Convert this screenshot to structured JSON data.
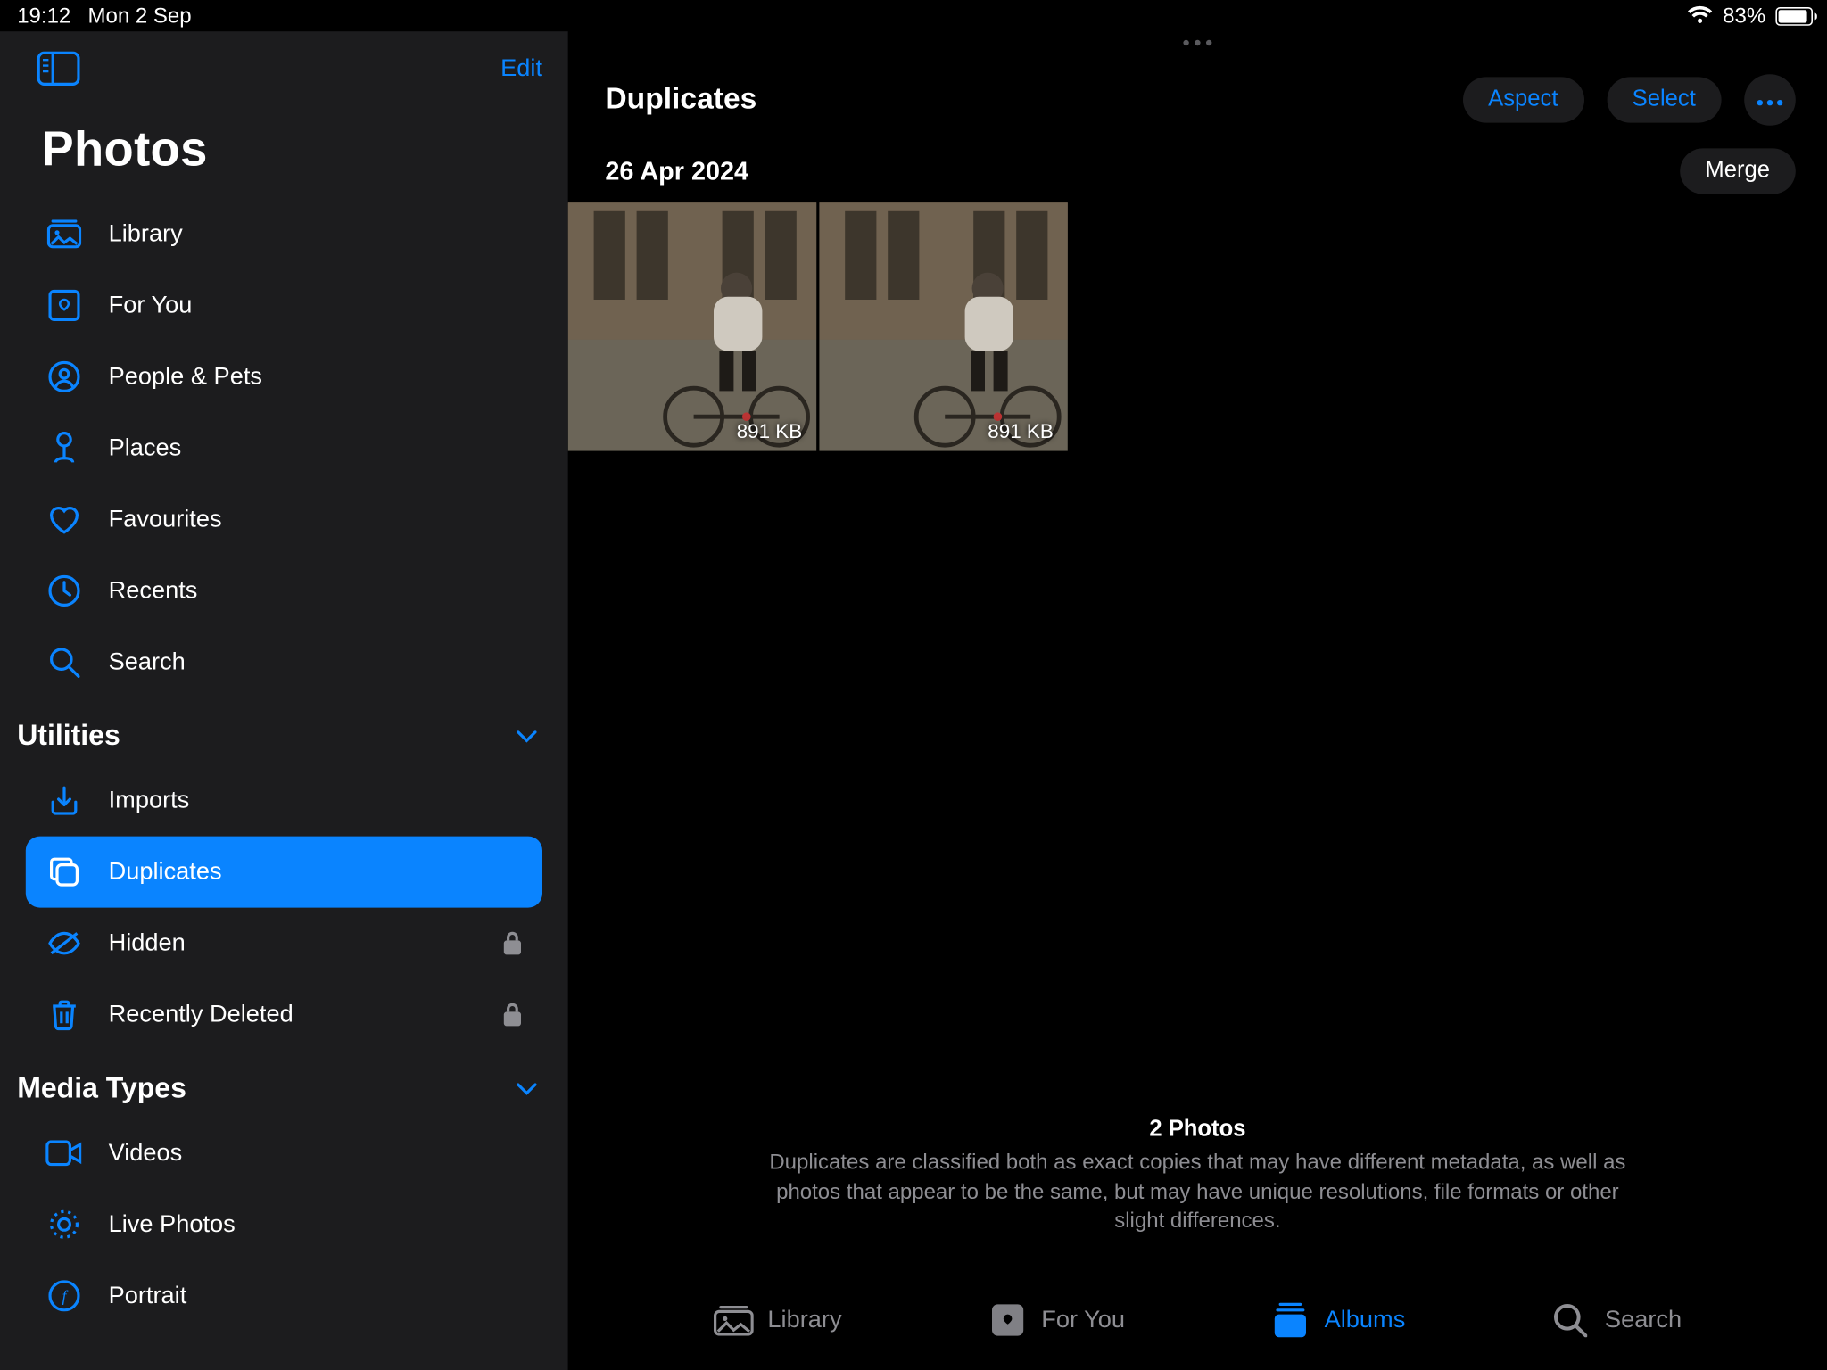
{
  "status": {
    "time": "19:12",
    "date": "Mon 2 Sep",
    "battery_pct": "83%",
    "battery_fill_pct": 83
  },
  "sidebar": {
    "edit_label": "Edit",
    "title": "Photos",
    "primary": [
      {
        "label": "Library",
        "icon": "library-icon"
      },
      {
        "label": "For You",
        "icon": "foryou-icon"
      },
      {
        "label": "People & Pets",
        "icon": "people-icon"
      },
      {
        "label": "Places",
        "icon": "places-icon"
      },
      {
        "label": "Favourites",
        "icon": "heart-icon"
      },
      {
        "label": "Recents",
        "icon": "clock-icon"
      },
      {
        "label": "Search",
        "icon": "search-icon"
      }
    ],
    "section_utilities": "Utilities",
    "utilities": [
      {
        "label": "Imports",
        "icon": "import-icon",
        "locked": false,
        "active": false
      },
      {
        "label": "Duplicates",
        "icon": "dup-icon",
        "locked": false,
        "active": true
      },
      {
        "label": "Hidden",
        "icon": "hidden-icon",
        "locked": true,
        "active": false
      },
      {
        "label": "Recently Deleted",
        "icon": "trash-icon",
        "locked": true,
        "active": false
      }
    ],
    "section_media": "Media Types",
    "media": [
      {
        "label": "Videos",
        "icon": "video-icon"
      },
      {
        "label": "Live Photos",
        "icon": "live-icon"
      },
      {
        "label": "Portrait",
        "icon": "portrait-icon"
      }
    ]
  },
  "header": {
    "title": "Duplicates",
    "aspect_label": "Aspect",
    "select_label": "Select"
  },
  "group": {
    "date": "26 Apr 2024",
    "merge_label": "Merge",
    "photos": [
      {
        "size": "891 KB"
      },
      {
        "size": "891 KB"
      }
    ]
  },
  "info": {
    "count": "2 Photos",
    "desc": "Duplicates are classified both as exact copies that may have different metadata, as well as photos that appear to be the same, but may have unique resolutions, file formats or other slight differences."
  },
  "tabs": {
    "library": "Library",
    "foryou": "For You",
    "albums": "Albums",
    "search": "Search"
  }
}
